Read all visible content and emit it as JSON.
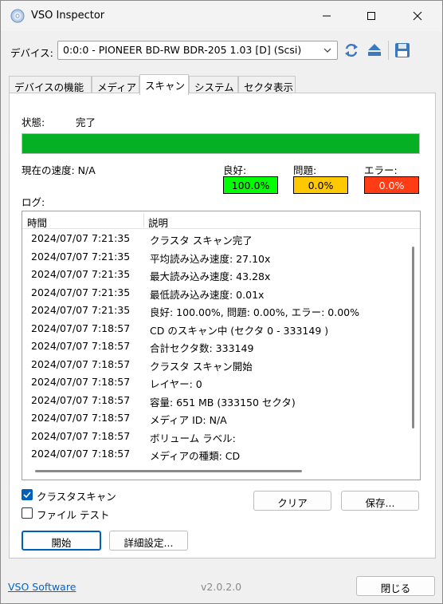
{
  "window": {
    "title": "VSO Inspector",
    "icon": "cd-disc-icon"
  },
  "device": {
    "label": "デバイス:",
    "value": "0:0:0 - PIONEER BD-RW   BDR-205 1.03 [D] (Scsi)"
  },
  "tabs": [
    {
      "label": "デバイスの機能"
    },
    {
      "label": "メディア"
    },
    {
      "label": "スキャン",
      "active": true
    },
    {
      "label": "システム"
    },
    {
      "label": "セクタ表示"
    }
  ],
  "scan": {
    "status_label": "状態:",
    "status_value": "完了",
    "progress": 1.0,
    "speed_label": "現在の速度: N/A",
    "good_label": "良好:",
    "good_value": "100.0%",
    "problem_label": "問題:",
    "problem_value": "0.0%",
    "error_label": "エラー:",
    "error_value": "0.0%",
    "log_label": "ログ:",
    "col_time": "時間",
    "col_desc": "説明",
    "log": [
      {
        "time": "2024/07/07 7:21:35",
        "desc": "クラスタ スキャン完了"
      },
      {
        "time": "2024/07/07 7:21:35",
        "desc": "平均読み込み速度: 27.10x"
      },
      {
        "time": "2024/07/07 7:21:35",
        "desc": "最大読み込み速度: 43.28x"
      },
      {
        "time": "2024/07/07 7:21:35",
        "desc": "最低読み込み速度: 0.01x"
      },
      {
        "time": "2024/07/07 7:21:35",
        "desc": "良好: 100.00%, 問題: 0.00%, エラー: 0.00%"
      },
      {
        "time": "2024/07/07 7:18:57",
        "desc": "CD のスキャン中 (セクタ 0 - 333149 )"
      },
      {
        "time": "2024/07/07 7:18:57",
        "desc": "合計セクタ数: 333149"
      },
      {
        "time": "2024/07/07 7:18:57",
        "desc": "クラスタ スキャン開始"
      },
      {
        "time": "2024/07/07 7:18:57",
        "desc": "レイヤー: 0"
      },
      {
        "time": "2024/07/07 7:18:57",
        "desc": "容量: 651 MB (333150 セクタ)"
      },
      {
        "time": "2024/07/07 7:18:57",
        "desc": "メディア ID: N/A"
      },
      {
        "time": "2024/07/07 7:18:57",
        "desc": "ボリューム ラベル:"
      },
      {
        "time": "2024/07/07 7:18:57",
        "desc": "メディアの種類: CD"
      }
    ],
    "cluster_scan_label": "クラスタスキャン",
    "cluster_scan_checked": true,
    "file_test_label": "ファイル テスト",
    "file_test_checked": false,
    "clear_label": "クリア",
    "save_label": "保存...",
    "start_label": "開始",
    "advanced_label": "詳細設定..."
  },
  "footer": {
    "link": "VSO Software",
    "version": "v2.0.2.0",
    "close_label": "閉じる"
  },
  "colors": {
    "progress": "#06b025",
    "good": "#00ff00",
    "problem": "#ffc800",
    "error": "#ff3c14",
    "accent": "#005fb8"
  }
}
